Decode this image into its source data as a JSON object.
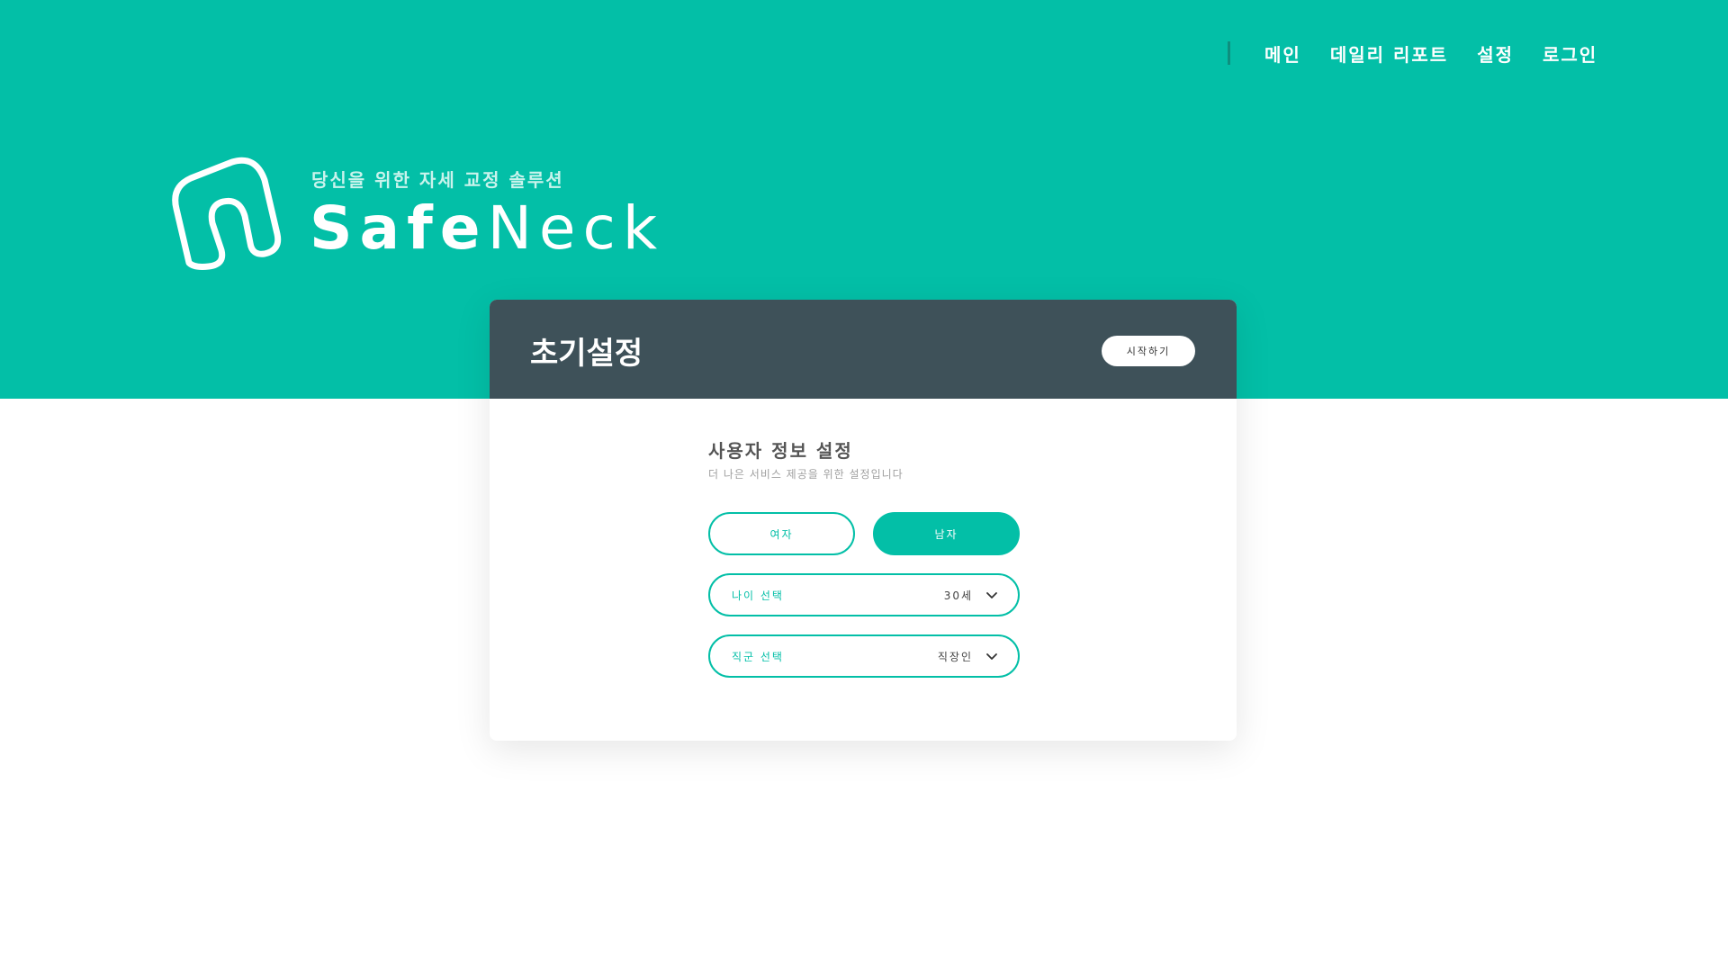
{
  "colors": {
    "accent": "#03BFA7",
    "header_dark": "#3E5159",
    "white": "#FFFFFF"
  },
  "nav": {
    "items": [
      {
        "label": "메인"
      },
      {
        "label": "데일리 리포트"
      },
      {
        "label": "설정"
      },
      {
        "label": "로그인"
      }
    ]
  },
  "brand": {
    "tagline": "당신을 위한 자세 교정 솔루션",
    "name_bold": "Safe",
    "name_light": "Neck",
    "logo_icon": "neck-outline-icon"
  },
  "card": {
    "title": "초기설정",
    "start_button": "시작하기",
    "section_title": "사용자 정보 설정",
    "section_subtitle": "더 나은 서비스 제공을 위한 설정입니다",
    "gender": {
      "female": "여자",
      "male": "남자",
      "selected": "남자"
    },
    "age_select": {
      "label": "나이 선택",
      "value": "30세",
      "icon": "chevron-down-icon"
    },
    "job_select": {
      "label": "직군 선택",
      "value": "직장인",
      "icon": "chevron-down-icon"
    }
  }
}
